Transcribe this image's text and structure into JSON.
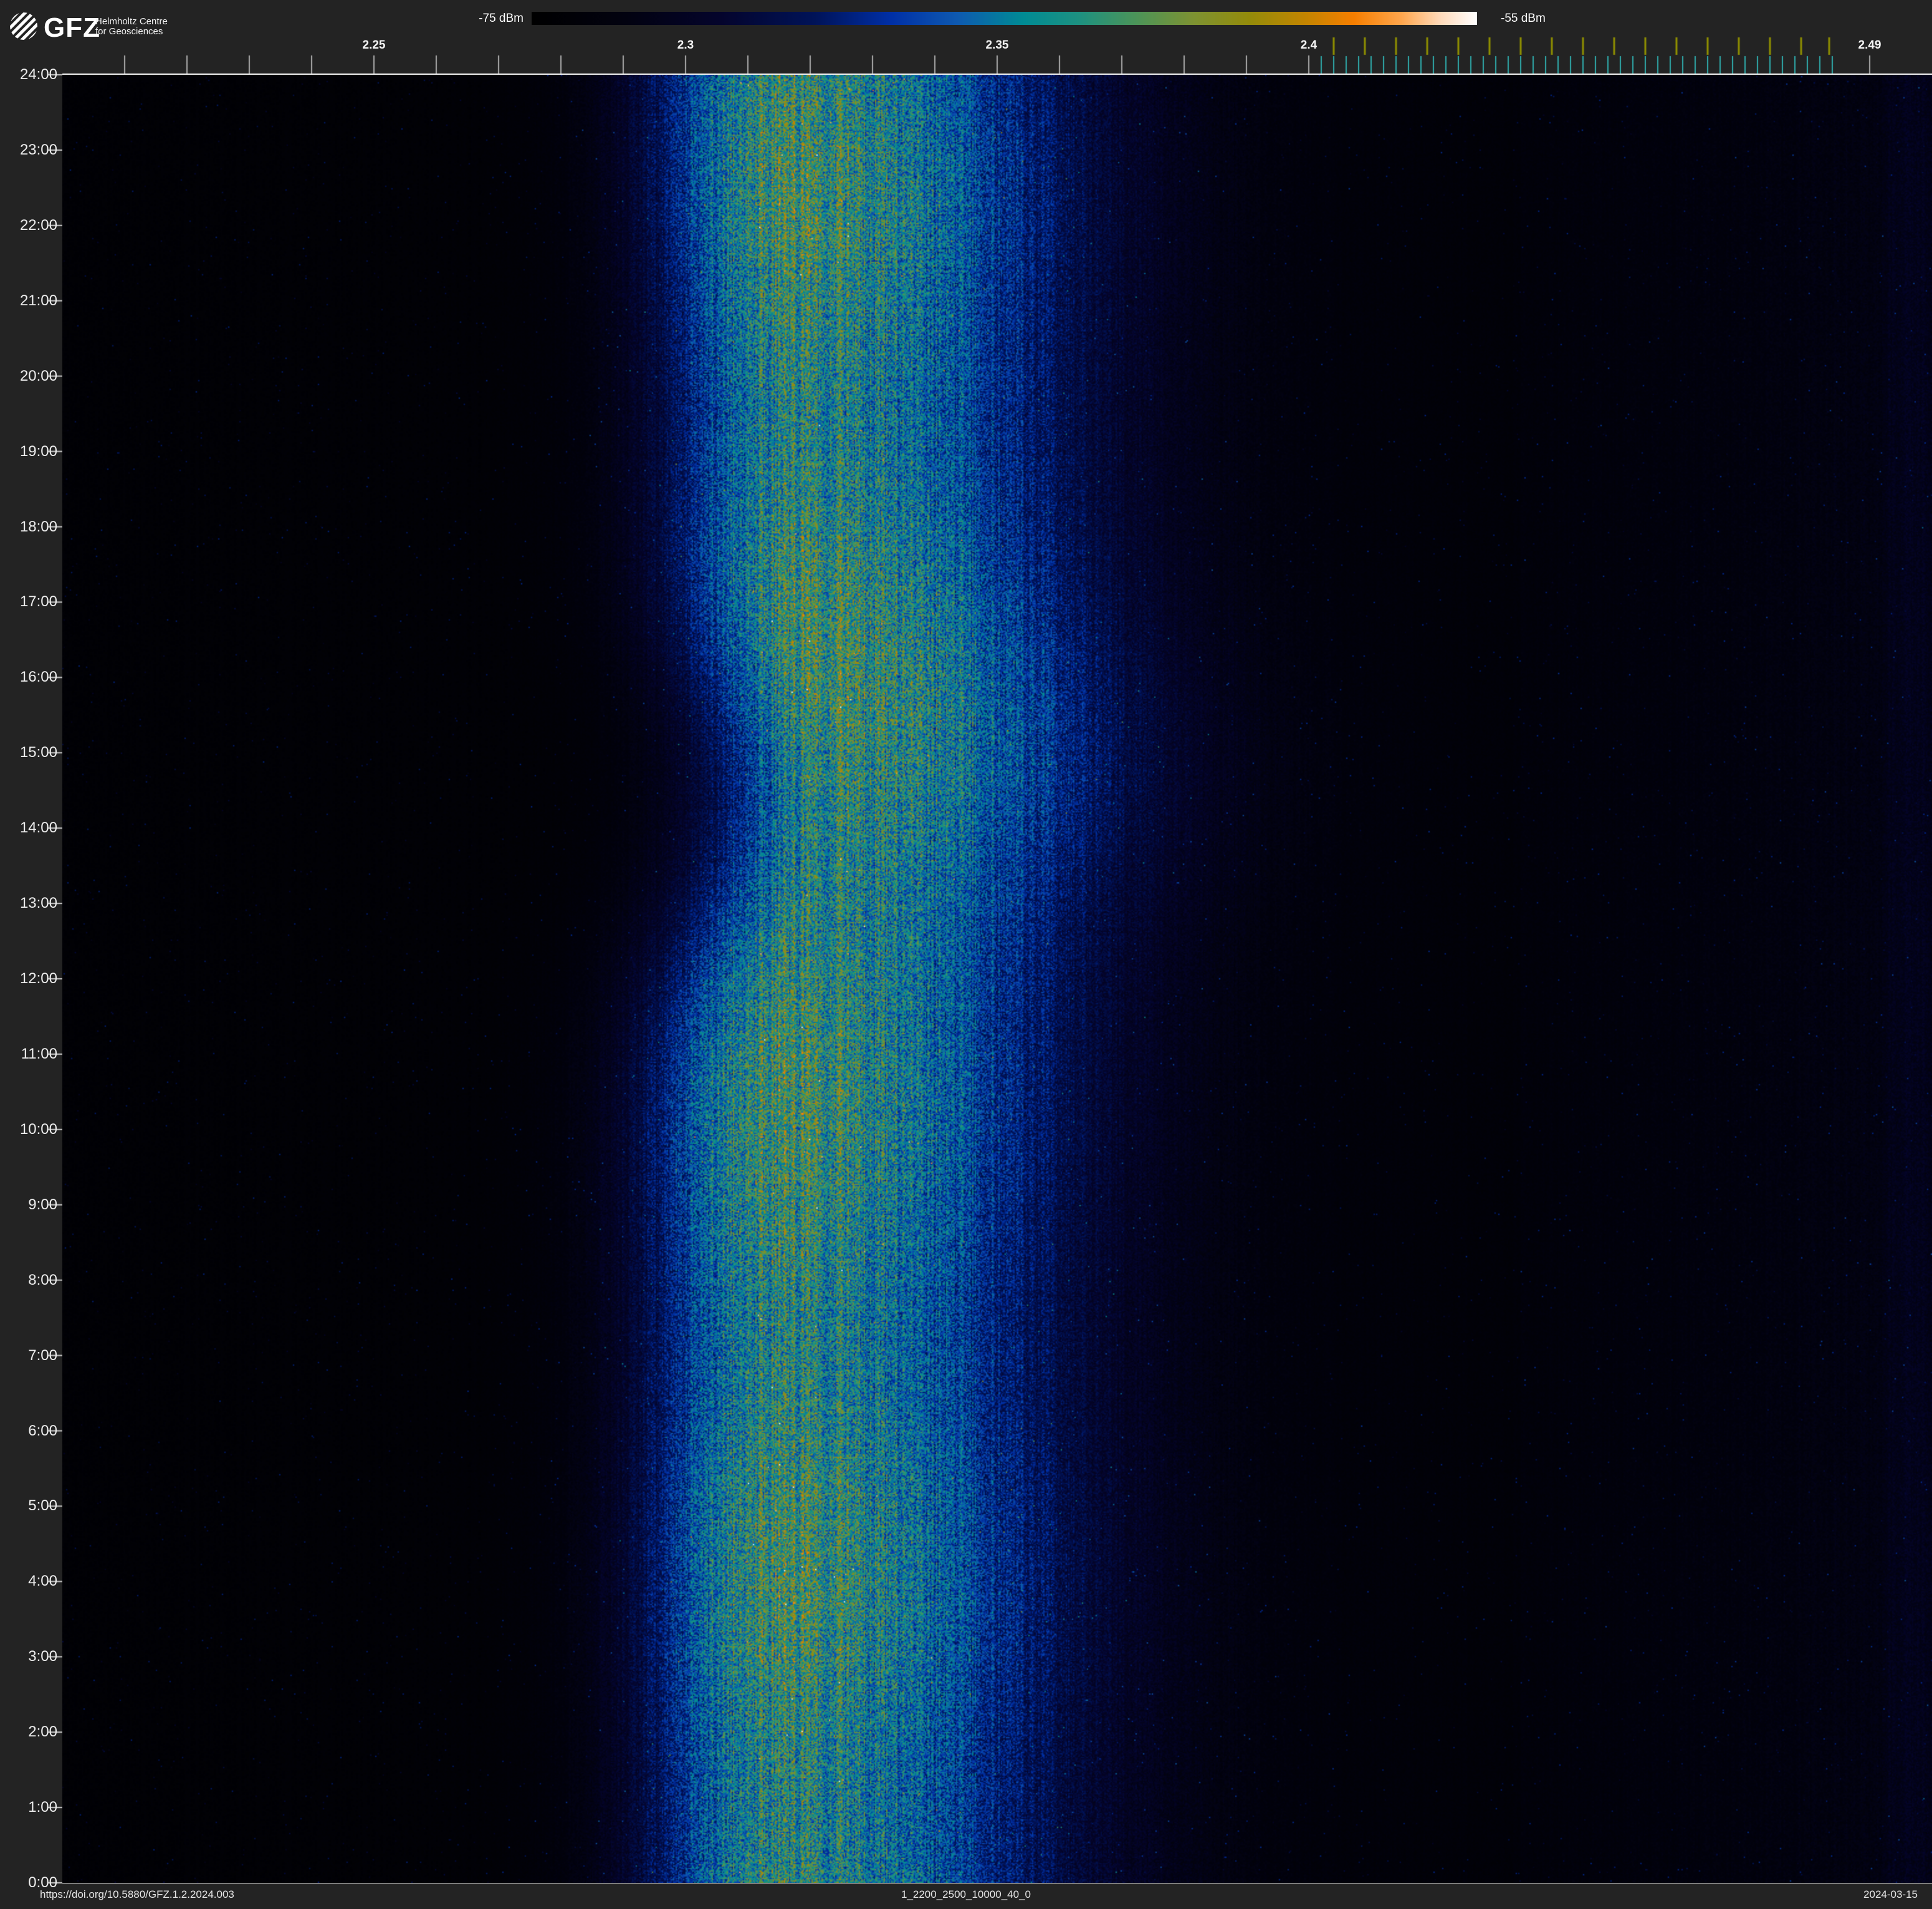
{
  "header": {
    "brand": "GFZ",
    "subtitle_line1": "Helmholtz Centre",
    "subtitle_line2": "for Geosciences"
  },
  "colorbar": {
    "min_label": "-75 dBm",
    "max_label": "-55 dBm",
    "stops": [
      [
        0.0,
        "#000000"
      ],
      [
        0.1,
        "#020210"
      ],
      [
        0.2,
        "#04042c"
      ],
      [
        0.3,
        "#001358"
      ],
      [
        0.38,
        "#002fa6"
      ],
      [
        0.45,
        "#0e59b0"
      ],
      [
        0.52,
        "#008b94"
      ],
      [
        0.58,
        "#1e9180"
      ],
      [
        0.64,
        "#4c9458"
      ],
      [
        0.7,
        "#7d9232"
      ],
      [
        0.76,
        "#948b0a"
      ],
      [
        0.82,
        "#c48400"
      ],
      [
        0.87,
        "#f67e00"
      ],
      [
        0.92,
        "#ffa64d"
      ],
      [
        0.96,
        "#ffd9b8"
      ],
      [
        1.0,
        "#ffffff"
      ]
    ]
  },
  "footer": {
    "doi": "https://doi.org/10.5880/GFZ.1.2.2024.003",
    "filename": "1_2200_2500_10000_40_0",
    "date": "2024-03-15"
  },
  "chart_data": {
    "type": "heatmap",
    "title": "24-hour radio-frequency spectrogram 2200-2500 MHz",
    "color_scale": {
      "min_dbm": -75,
      "max_dbm": -55
    },
    "x_axis": {
      "unit": "GHz",
      "min_ghz": 2.2,
      "max_ghz": 2.4983,
      "major_ticks": [
        {
          "label": "2.25",
          "ghz": 2.25
        },
        {
          "label": "2.3",
          "ghz": 2.3
        },
        {
          "label": "2.35",
          "ghz": 2.35
        },
        {
          "label": "2.4",
          "ghz": 2.4
        },
        {
          "label": "2.49",
          "ghz": 2.49
        }
      ],
      "minor_ticks": {
        "from": 2.21,
        "to": 2.4,
        "step_ghz": 0.01
      },
      "teal_ticks": {
        "from": 2.402,
        "to": 2.484,
        "step_ghz": 0.002
      },
      "olive_ticks": {
        "from": 2.404,
        "to": 2.479,
        "step_ghz": 0.005,
        "extra": [
          2.4835
        ]
      }
    },
    "y_axis": {
      "unit": "time of day",
      "top_label": "24:00",
      "bottom_label": "0:00",
      "hour_labels": [
        "24:00",
        "23:00",
        "22:00",
        "21:00",
        "20:00",
        "19:00",
        "18:00",
        "17:00",
        "16:00",
        "15:00",
        "14:00",
        "13:00",
        "12:00",
        "11:00",
        "10:00",
        "9:00",
        "8:00",
        "7:00",
        "6:00",
        "5:00",
        "4:00",
        "3:00",
        "2:00",
        "1:00",
        "0:00"
      ]
    },
    "noise_floor_segments": [
      [
        2.2,
        2.296,
        0.034,
        0.04
      ],
      [
        2.296,
        2.39,
        0.042,
        0.048
      ],
      [
        2.39,
        2.434,
        0.05,
        0.054
      ],
      [
        2.434,
        2.47,
        0.064,
        0.085
      ],
      [
        2.47,
        2.492,
        0.085,
        0.105
      ],
      [
        2.492,
        2.499,
        0.125,
        0.15
      ]
    ],
    "main_band": {
      "center_ghz": 2.3145,
      "sigma_left_ghz": 0.0155,
      "sigma_right_ghz": 0.0335,
      "peak_level": 0.565,
      "drift_bumps": [
        {
          "t_hours": 14.5,
          "delta_ghz": 0.0095,
          "width_hours": 2.2
        },
        {
          "t_hours": 19.2,
          "delta_ghz": 0.0028,
          "width_hours": 4.2
        }
      ]
    },
    "carriers": [
      {
        "ghz": 2.2747,
        "color": "rgba(45,165,195,0.40)",
        "width": 2
      },
      {
        "ghz": 2.36,
        "color": "rgba(186,138,10,0.95)",
        "width": 3
      },
      {
        "ghz": 2.4121,
        "color": "rgba(80,195,220,0.55)",
        "width": 2,
        "dash": [
          7,
          26
        ]
      },
      {
        "ghz": 2.4174,
        "color": "rgba(60,175,205,0.28)",
        "width": 2
      },
      {
        "ghz": 2.4274,
        "color": "rgba(85,200,225,0.85)",
        "width": 2
      },
      {
        "ghz": 2.4374,
        "color": "rgba(85,200,225,0.80)",
        "width": 2
      },
      {
        "ghz": 2.4672,
        "color": "rgba(175,180,190,0.28)",
        "width": 2
      }
    ],
    "bursts": [
      {
        "t": 13.31,
        "f1": 2.4008,
        "f2": 2.4028,
        "color": "#2a6ad0"
      },
      {
        "t": 13.31,
        "f1": 2.4029,
        "f2": 2.4036,
        "color": "#35b3c4"
      },
      {
        "t": 13.31,
        "f1": 2.4048,
        "f2": 2.4066,
        "color": "#2f9a60"
      },
      {
        "t": 13.31,
        "f1": 2.4066,
        "f2": 2.4071,
        "color": "#45b5c5"
      },
      {
        "t": 13.31,
        "f1": 2.4098,
        "f2": 2.4106,
        "color": "#d39424"
      },
      {
        "t": 13.31,
        "f1": 2.4106,
        "f2": 2.4111,
        "color": "#3372c8"
      },
      {
        "t": 13.31,
        "f1": 2.4112,
        "f2": 2.412,
        "color": "#c9a423"
      },
      {
        "t": 13.31,
        "f1": 2.4125,
        "f2": 2.4147,
        "color": "#8f9a28"
      },
      {
        "t": 13.31,
        "f1": 2.4148,
        "f2": 2.4174,
        "color": "#f7f7ef"
      },
      {
        "t": 13.31,
        "f1": 2.4178,
        "f2": 2.4182,
        "color": "#e9e9e9"
      },
      {
        "t": 13.31,
        "f1": 2.4186,
        "f2": 2.4189,
        "color": "#efefef"
      },
      {
        "t": 13.31,
        "f1": 2.4193,
        "f2": 2.4196,
        "color": "#ffffff"
      },
      {
        "t": 13.31,
        "f1": 2.42,
        "f2": 2.4203,
        "color": "#e9e9e9"
      },
      {
        "t": 13.31,
        "f1": 2.4225,
        "f2": 2.4228,
        "color": "#f1f1f1"
      },
      {
        "t": 13.31,
        "f1": 2.4232,
        "f2": 2.4235,
        "color": "#f1f1f1"
      },
      {
        "t": 13.31,
        "f1": 2.4239,
        "f2": 2.4242,
        "color": "#f1f1f1"
      },
      {
        "t": 13.31,
        "f1": 2.4297,
        "f2": 2.4311,
        "color": "#9b9b22"
      },
      {
        "t": 13.31,
        "f1": 2.4311,
        "f2": 2.4322,
        "color": "#4a9a52"
      },
      {
        "t": 13.51,
        "f1": 2.4826,
        "f2": 2.4832,
        "color": "#69d7e3"
      },
      {
        "t": 12.25,
        "f1": 2.4186,
        "f2": 2.4189,
        "color": "#e09432"
      },
      {
        "t": 12.25,
        "f1": 2.4189,
        "f2": 2.4198,
        "color": "#fdf7e6"
      },
      {
        "t": 12.04,
        "f1": 2.4245,
        "f2": 2.4249,
        "color": "#2a58c4"
      },
      {
        "t": 12.04,
        "f1": 2.4251,
        "f2": 2.4256,
        "color": "#2a58c4"
      },
      {
        "t": 12.04,
        "f1": 2.4258,
        "f2": 2.4262,
        "color": "#2a58c4"
      },
      {
        "t": 12.04,
        "f1": 2.4265,
        "f2": 2.4271,
        "color": "#3160cc"
      },
      {
        "t": 9.6,
        "f1": 2.4107,
        "f2": 2.4113,
        "color": "#3a78d0"
      },
      {
        "t": 9.6,
        "f1": 2.4115,
        "f2": 2.4119,
        "color": "#3a78d0"
      },
      {
        "t": 9.6,
        "f1": 2.4121,
        "f2": 2.4124,
        "color": "#45c2d2"
      },
      {
        "t": 9.05,
        "f1": 2.3885,
        "f2": 2.3907,
        "color": "#24409a"
      },
      {
        "t": 11.62,
        "f1": 2.4125,
        "f2": 2.4127,
        "color": "#d08a20",
        "h": 9
      }
    ]
  }
}
